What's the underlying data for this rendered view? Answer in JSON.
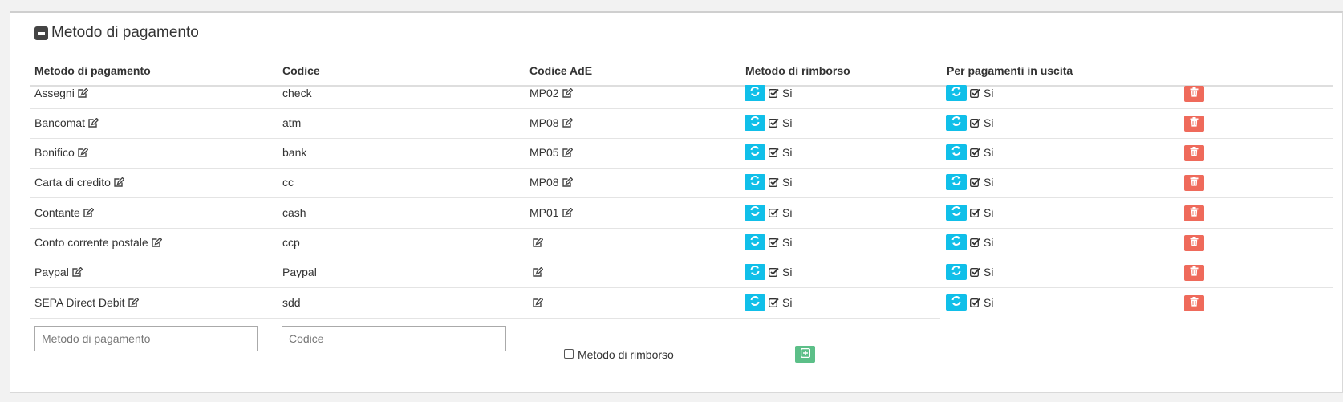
{
  "panel": {
    "title": "Metodo di pagamento"
  },
  "headers": {
    "metodo": "Metodo di pagamento",
    "codice": "Codice",
    "codice_ade": "Codice AdE",
    "rimborso": "Metodo di rimborso",
    "uscita": "Per pagamenti in uscita"
  },
  "rows": [
    {
      "metodo": "Assegni",
      "codice": "check",
      "codice_ade": "MP02",
      "rimborso": "Si",
      "uscita": "Si"
    },
    {
      "metodo": "Bancomat",
      "codice": "atm",
      "codice_ade": "MP08",
      "rimborso": "Si",
      "uscita": "Si"
    },
    {
      "metodo": "Bonifico",
      "codice": "bank",
      "codice_ade": "MP05",
      "rimborso": "Si",
      "uscita": "Si"
    },
    {
      "metodo": "Carta di credito",
      "codice": "cc",
      "codice_ade": "MP08",
      "rimborso": "Si",
      "uscita": "Si"
    },
    {
      "metodo": "Contante",
      "codice": "cash",
      "codice_ade": "MP01",
      "rimborso": "Si",
      "uscita": "Si"
    },
    {
      "metodo": "Conto corrente postale",
      "codice": "ccp",
      "codice_ade": "",
      "rimborso": "Si",
      "uscita": "Si"
    },
    {
      "metodo": "Paypal",
      "codice": "Paypal",
      "codice_ade": "",
      "rimborso": "Si",
      "uscita": "Si"
    },
    {
      "metodo": "SEPA Direct Debit",
      "codice": "sdd",
      "codice_ade": "",
      "rimborso": "Si",
      "uscita": "Si"
    }
  ],
  "new_row": {
    "metodo_placeholder": "Metodo di pagamento",
    "codice_placeholder": "Codice",
    "rimborso_label": "Metodo di rimborso"
  },
  "colors": {
    "sync": "#10bfe9",
    "delete": "#ef6a5b",
    "add": "#5cbf88"
  },
  "icons": {
    "edit": "edit-icon",
    "sync": "refresh-icon",
    "check": "check-square-icon",
    "delete": "trash-icon",
    "add": "plus-square-icon",
    "collapse": "minus-square-icon"
  }
}
